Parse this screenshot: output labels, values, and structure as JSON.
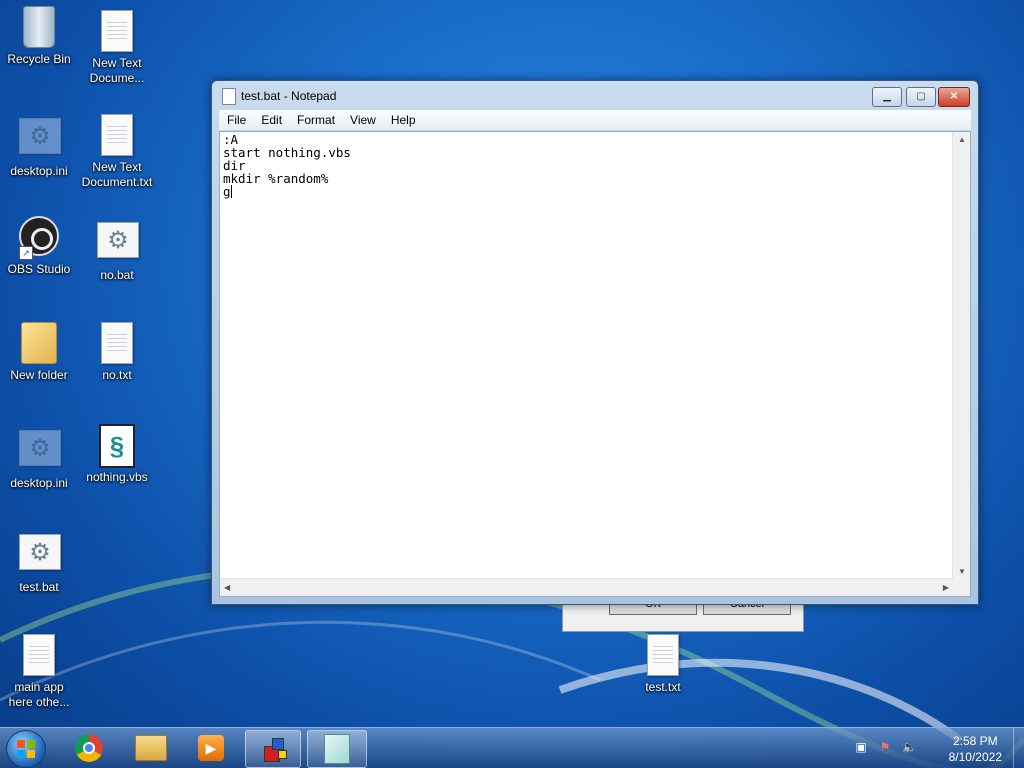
{
  "desktop": {
    "icons": [
      {
        "label": "Recycle Bin",
        "icon": "recycle-bin-icon"
      },
      {
        "label": "New Text\nDocume...",
        "icon": "text-file-icon"
      },
      {
        "label": "desktop.ini",
        "icon": "config-file-icon"
      },
      {
        "label": "New Text\nDocument.txt",
        "icon": "text-file-icon"
      },
      {
        "label": "OBS Studio",
        "icon": "obs-studio-icon"
      },
      {
        "label": "no.bat",
        "icon": "batch-file-icon"
      },
      {
        "label": "New folder",
        "icon": "folder-icon"
      },
      {
        "label": "no.txt",
        "icon": "text-file-icon"
      },
      {
        "label": "desktop.ini",
        "icon": "config-file-icon"
      },
      {
        "label": "nothing.vbs",
        "icon": "script-file-icon"
      },
      {
        "label": "test.bat",
        "icon": "batch-file-icon"
      },
      {
        "label": "main app\nhere othe...",
        "icon": "text-file-icon"
      },
      {
        "label": "test.txt",
        "icon": "text-file-icon"
      }
    ]
  },
  "background_dialog": {
    "ok_label": "OK",
    "cancel_label": "Cancel"
  },
  "notepad": {
    "title": "test.bat - Notepad",
    "menu": [
      "File",
      "Edit",
      "Format",
      "View",
      "Help"
    ],
    "content": ":A\nstart nothing.vbs\ndir\nmkdir %random%\ng",
    "window_buttons": {
      "minimize": "▁",
      "maximize": "▢",
      "close": "✕"
    }
  },
  "taskbar": {
    "pinned": [
      "start-button",
      "chrome-icon",
      "file-explorer-icon",
      "media-player-icon",
      "app-cube-icon",
      "notepad-icon"
    ],
    "active": "notepad-icon",
    "tray": {
      "time": "2:58 PM",
      "date": "8/10/2022"
    }
  },
  "colors": {
    "desktop_blue": "#1a6fcc",
    "taskbar": "#2d5a93",
    "close_red": "#c9402a"
  }
}
